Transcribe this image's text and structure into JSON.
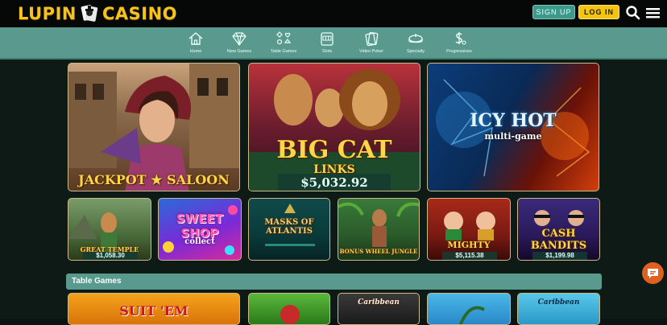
{
  "header": {
    "logo_left": "LUPIN",
    "logo_right": "CASINO",
    "signup_label": "SIGN UP",
    "login_label": "LOG IN"
  },
  "nav": {
    "items": [
      {
        "label": "Home",
        "icon": "house-icon"
      },
      {
        "label": "New Games",
        "icon": "diamond-icon"
      },
      {
        "label": "Table Games",
        "icon": "card-suits-icon"
      },
      {
        "label": "Slots",
        "icon": "slot-machine-icon"
      },
      {
        "label": "Video Poker",
        "icon": "playing-cards-icon"
      },
      {
        "label": "Specialty",
        "icon": "roulette-icon"
      },
      {
        "label": "Progressives",
        "icon": "money-icon"
      }
    ]
  },
  "featured": [
    {
      "title": "JACKPOT ★ SALOON",
      "jackpot": ""
    },
    {
      "title": "BIG CAT",
      "subtitle": "LINKS",
      "jackpot": "$5,032.92"
    },
    {
      "title": "ICY HOT",
      "subtitle": "multi-game",
      "jackpot": ""
    }
  ],
  "games": [
    {
      "title": "GREAT TEMPLE",
      "jackpot": "$1,058.30"
    },
    {
      "title": "SWEET SHOP",
      "subtitle": "collect",
      "jackpot": ""
    },
    {
      "title": "MASKS OF ATLANTIS",
      "jackpot": ""
    },
    {
      "title": "BONUS WHEEL JUNGLE",
      "jackpot": ""
    },
    {
      "title": "MIGHTY",
      "jackpot": "$5,115.38"
    },
    {
      "title": "CASH BANDITS",
      "jackpot": "$1,199.98"
    }
  ],
  "section": {
    "title": "Table Games"
  },
  "table_games": [
    {
      "title": "SUIT 'EM"
    },
    {
      "title": ""
    },
    {
      "title": "Caribbean"
    },
    {
      "title": ""
    },
    {
      "title": "Caribbean"
    }
  ],
  "colors": {
    "accent": "#5a9a8e",
    "gold": "#f6c21b",
    "chat": "#e2601f"
  }
}
